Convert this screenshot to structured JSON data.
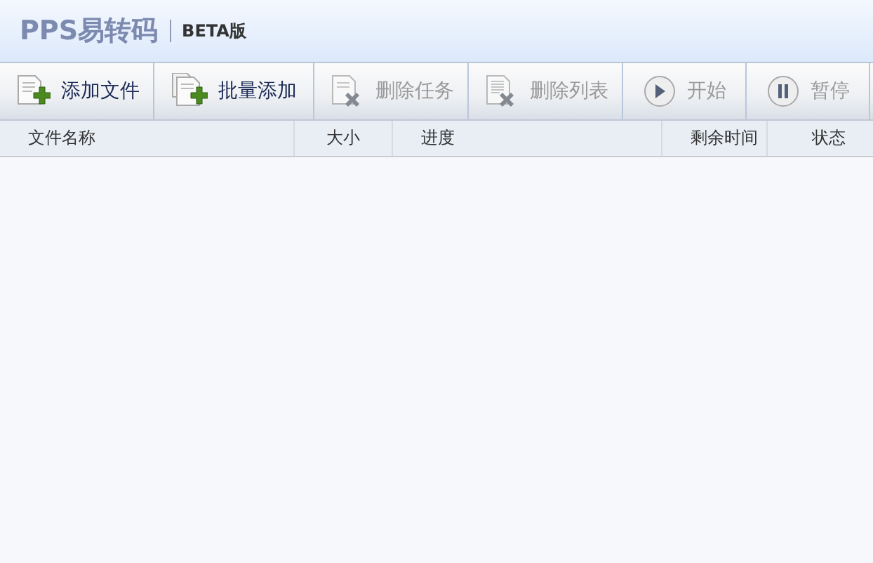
{
  "app": {
    "logo": "PPS易转码",
    "edition": "BETA版"
  },
  "toolbar": [
    {
      "label": "添加文件",
      "kind": "add-file",
      "disabled": false
    },
    {
      "label": "批量添加",
      "kind": "add-batch",
      "disabled": false
    },
    {
      "label": "删除任务",
      "kind": "delete",
      "disabled": true
    },
    {
      "label": "删除列表",
      "kind": "delete-list",
      "disabled": true
    },
    {
      "label": "开始",
      "kind": "play",
      "disabled": true
    },
    {
      "label": "暂停",
      "kind": "pause",
      "disabled": true
    }
  ],
  "table": {
    "columns": [
      "文件名称",
      "大小",
      "进度",
      "剩余时间",
      "状态"
    ]
  }
}
